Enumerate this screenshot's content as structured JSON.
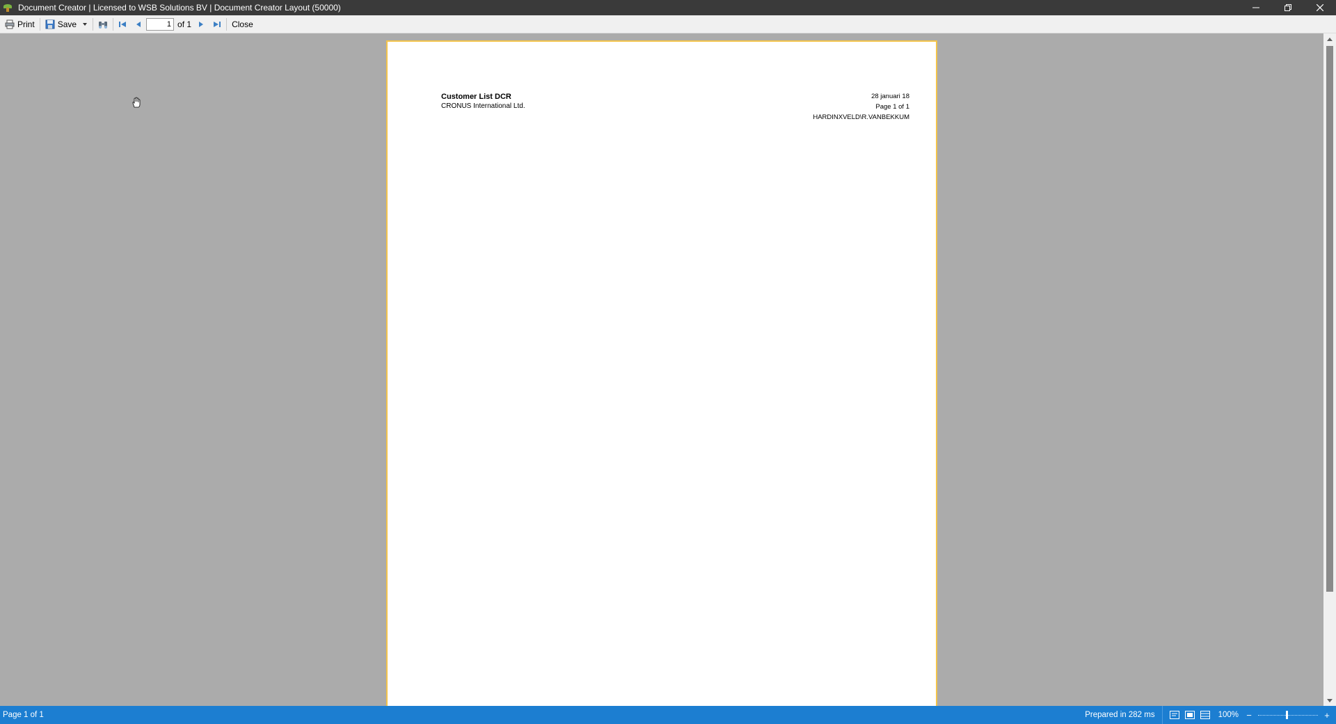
{
  "window": {
    "title": "Document Creator | Licensed to WSB Solutions BV | Document Creator Layout (50000)",
    "icon": "app-logo-icon",
    "controls": [
      "minimize-icon",
      "restore-icon",
      "close-icon"
    ]
  },
  "toolbar": {
    "print_label": "Print",
    "save_label": "Save",
    "page_value": "1",
    "of_label": "of 1",
    "close_label": "Close"
  },
  "report": {
    "title": "Customer List DCR",
    "company": "CRONUS International Ltd.",
    "date": "28 januari 18",
    "page": "Page 1 of 1",
    "user": "HARDINXVELD\\R.VANBEKKUM"
  },
  "status": {
    "page_info": "Page 1 of 1",
    "prepared": "Prepared in 282 ms",
    "zoom": "100%",
    "zoom_out": "−",
    "zoom_in": "+"
  },
  "colors": {
    "title_bar": "#3a3a3a",
    "status_bar": "#1c7ed1",
    "viewer_bg": "#ababab",
    "page_border": "#f3c44b"
  }
}
